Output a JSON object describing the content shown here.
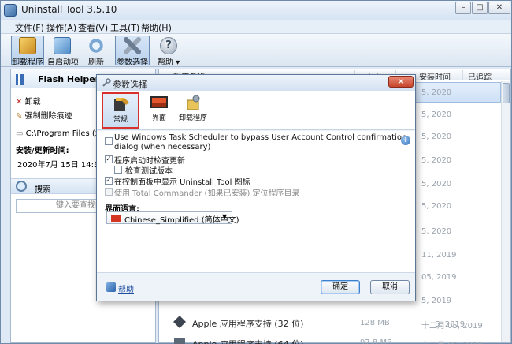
{
  "window": {
    "title": "Uninstall Tool 3.5.10"
  },
  "menu": [
    "文件(F)",
    "操作(A)",
    "查看(V)",
    "工具(T)",
    "帮助(H)"
  ],
  "toolbar": {
    "uninstaller": "卸载程序",
    "autorun": "自启动项",
    "refresh": "刷新",
    "settings": "参数选择",
    "help": "帮助"
  },
  "left_panel": {
    "title": "Flash Helper Serv",
    "uninstall": "卸载",
    "force_remove": "强制删除痕迹",
    "path": "C:\\Program Files (x8",
    "install_label": "安装/更新时间:",
    "install_date": "2020年7月 15日 14:31:19",
    "search_label": "搜索",
    "search_placeholder": "键入要查找的程"
  },
  "list": {
    "columns": {
      "name": "程序名称",
      "size": "大小",
      "install_time": "安装时间",
      "traced": "已追踪"
    },
    "rows": [
      {
        "date": "5, 2020"
      },
      {
        "date": "5, 2020"
      },
      {
        "date": "5, 2020"
      },
      {
        "date": "5, 2020"
      },
      {
        "date": "5, 2020"
      },
      {
        "date": "5, 2020"
      },
      {
        "date": "5, 2020"
      },
      {
        "date": "11, 2019"
      },
      {
        "date": "05, 2019"
      },
      {
        "date": "5, 2019"
      },
      {
        "date": "5, 2019"
      },
      {
        "name": "Apple 应用程序支持 (32 位)",
        "size": "128 MB",
        "date": "十二月 05, 2019"
      },
      {
        "name": "Apple 应用程序支持 (64 位)",
        "size": "97.8 MB",
        "date": "十二月 05, 2019"
      }
    ]
  },
  "dialog": {
    "title": "参数选择",
    "close": "✕",
    "tabs": {
      "general": "常规",
      "interface": "界面",
      "uninstaller": "卸载程序"
    },
    "options": {
      "uac_line1": "Use Windows Task Scheduler to bypass User Account Control confirmation",
      "uac_line2": "dialog (when necessary)",
      "check_updates": "程序启动时检查更新",
      "check_beta": "检查测试版本",
      "show_in_cp": "在控制面板中显示 Uninstall Tool 图标",
      "total_commander": "使用 Total Commander (如果已安装) 定位程序目录"
    },
    "language_label": "界面语言:",
    "language_value": "Chinese_Simplified (简体中文)",
    "help": "帮助",
    "ok": "确定",
    "cancel": "取消"
  }
}
